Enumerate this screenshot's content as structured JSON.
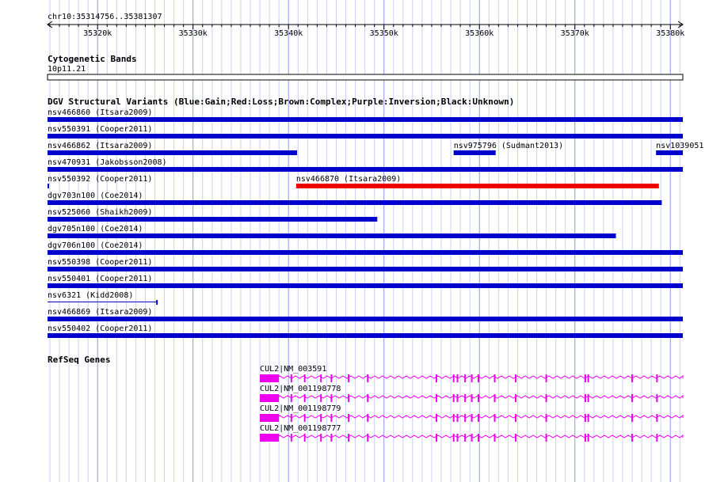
{
  "ruler": {
    "locus": "chr10:35314756..35381307",
    "ticks": [
      "35320k",
      "35330k",
      "35340k",
      "35350k",
      "35360k",
      "35370k",
      "35380k"
    ]
  },
  "cyto": {
    "title": "Cytogenetic Bands",
    "band": "10p11.21"
  },
  "dgv": {
    "title": "DGV Structural Variants (Blue:Gain;Red:Loss;Brown:Complex;Purple:Inversion;Black:Unknown)",
    "colors": {
      "gain": "#0000cc",
      "loss": "#ee0000"
    },
    "rows": [
      {
        "items": [
          {
            "label": "nsv466860 (Itsara2009)",
            "start": 35314756,
            "end": 35381307,
            "type": "gain"
          }
        ]
      },
      {
        "items": [
          {
            "label": "nsv550391 (Cooper2011)",
            "start": 35314756,
            "end": 35381307,
            "type": "gain"
          }
        ]
      },
      {
        "items": [
          {
            "label": "nsv466862 (Itsara2009)",
            "start": 35314756,
            "end": 35340900,
            "type": "gain"
          },
          {
            "label": "nsv975796 (Sudmant2013)",
            "start": 35357300,
            "end": 35361700,
            "type": "gain"
          },
          {
            "label": "nsv1039051",
            "start": 35378500,
            "end": 35381307,
            "type": "gain"
          }
        ]
      },
      {
        "items": [
          {
            "label": "nsv470931 (Jakobsson2008)",
            "start": 35314756,
            "end": 35381307,
            "type": "gain"
          }
        ]
      },
      {
        "items": [
          {
            "label": "nsv550392 (Cooper2011)",
            "start": 35314756,
            "end": 35314900,
            "type": "gain"
          },
          {
            "label": "nsv466870 (Itsara2009)",
            "start": 35340800,
            "end": 35378800,
            "type": "loss"
          }
        ]
      },
      {
        "items": [
          {
            "label": "dgv703n100 (Coe2014)",
            "start": 35314756,
            "end": 35379100,
            "type": "gain"
          }
        ]
      },
      {
        "items": [
          {
            "label": "nsv525060 (Shaikh2009)",
            "start": 35314756,
            "end": 35349300,
            "type": "gain"
          }
        ]
      },
      {
        "items": [
          {
            "label": "dgv705n100 (Coe2014)",
            "start": 35314756,
            "end": 35374300,
            "type": "gain"
          }
        ]
      },
      {
        "items": [
          {
            "label": "dgv706n100 (Coe2014)",
            "start": 35314756,
            "end": 35381307,
            "type": "gain"
          }
        ]
      },
      {
        "items": [
          {
            "label": "nsv550398 (Cooper2011)",
            "start": 35314756,
            "end": 35381307,
            "type": "gain"
          }
        ]
      },
      {
        "items": [
          {
            "label": "nsv550401 (Cooper2011)",
            "start": 35314756,
            "end": 35381307,
            "type": "gain"
          }
        ]
      },
      {
        "items": [
          {
            "label": "nsv6321 (Kidd2008)",
            "start": 35314756,
            "end": 35326300,
            "type": "gain",
            "style": "line"
          }
        ]
      },
      {
        "items": [
          {
            "label": "nsv466869 (Itsara2009)",
            "start": 35314756,
            "end": 35381307,
            "type": "gain"
          }
        ]
      },
      {
        "items": [
          {
            "label": "nsv550402 (Cooper2011)",
            "start": 35314756,
            "end": 35381307,
            "type": "gain"
          }
        ]
      }
    ]
  },
  "genes": {
    "title": "RefSeq Genes",
    "color": "#ee00ee",
    "transcripts": [
      {
        "label": "CUL2|NM_003591"
      },
      {
        "label": "CUL2|NM_001198778"
      },
      {
        "label": "CUL2|NM_001198779"
      },
      {
        "label": "CUL2|NM_001198777"
      }
    ],
    "span": [
      35337000,
      35381307
    ],
    "first_exon": [
      35337000,
      35339000
    ],
    "exons": [
      35340300,
      35341700,
      35343400,
      35344500,
      35346300,
      35348300,
      35355500,
      35357300,
      35357700,
      35358500,
      35359200,
      35359900,
      35361600,
      35363800,
      35367000,
      35371100,
      35371400,
      35376000,
      35378600
    ]
  }
}
